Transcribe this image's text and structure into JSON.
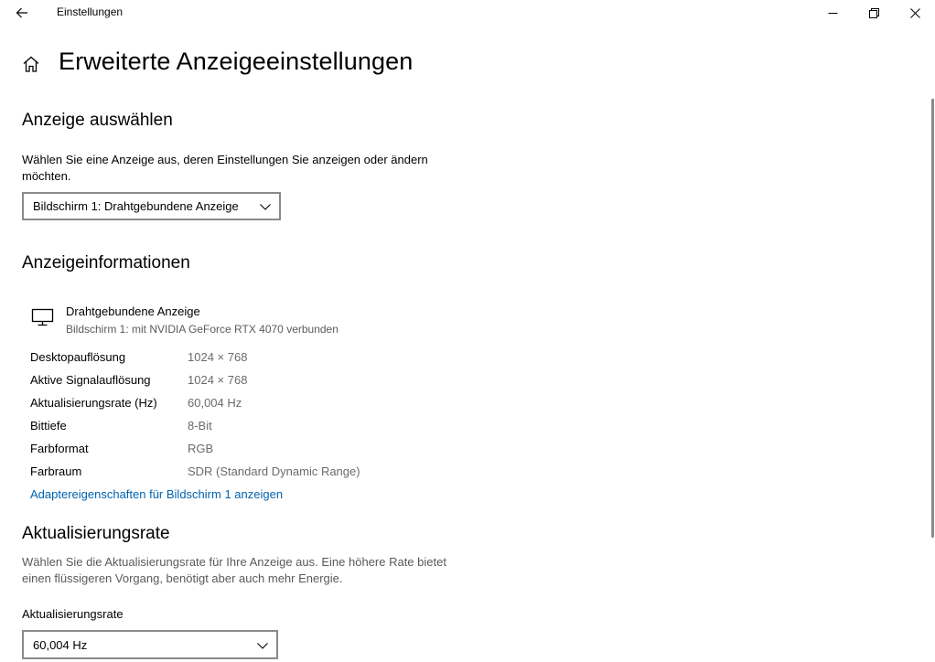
{
  "window": {
    "app_title": "Einstellungen",
    "back_icon": "arrow-left-icon",
    "minimize_icon": "minimize-icon",
    "restore_icon": "restore-icon",
    "close_icon": "close-icon"
  },
  "page": {
    "title": "Erweiterte Anzeigeeinstellungen",
    "home_icon": "home-icon"
  },
  "select_display": {
    "heading": "Anzeige auswählen",
    "description": "Wählen Sie eine Anzeige aus, deren Einstellungen Sie anzeigen oder ändern möchten.",
    "selected": "Bildschirm 1: Drahtgebundene Anzeige"
  },
  "display_info": {
    "heading": "Anzeigeinformationen",
    "icon": "monitor-icon",
    "name": "Drahtgebundene Anzeige",
    "subtitle": "Bildschirm 1: mit NVIDIA GeForce RTX 4070 verbunden",
    "rows": [
      {
        "label": "Desktopauflösung",
        "value": "1024 × 768"
      },
      {
        "label": "Aktive Signalauflösung",
        "value": "1024 × 768"
      },
      {
        "label": "Aktualisierungsrate (Hz)",
        "value": "60,004 Hz"
      },
      {
        "label": "Bittiefe",
        "value": "8-Bit"
      },
      {
        "label": "Farbformat",
        "value": "RGB"
      },
      {
        "label": "Farbraum",
        "value": "SDR (Standard Dynamic Range)"
      }
    ],
    "adapter_link": "Adaptereigenschaften für Bildschirm 1 anzeigen"
  },
  "refresh_rate": {
    "heading": "Aktualisierungsrate",
    "description": "Wählen Sie die Aktualisierungsrate für Ihre Anzeige aus. Eine höhere Rate bietet einen flüssigeren Vorgang, benötigt aber auch mehr Energie.",
    "field_label": "Aktualisierungsrate",
    "selected": "60,004 Hz"
  },
  "colors": {
    "link": "#0063b1",
    "muted_text": "#5a5a5a",
    "dropdown_border": "#8a8a8a"
  }
}
